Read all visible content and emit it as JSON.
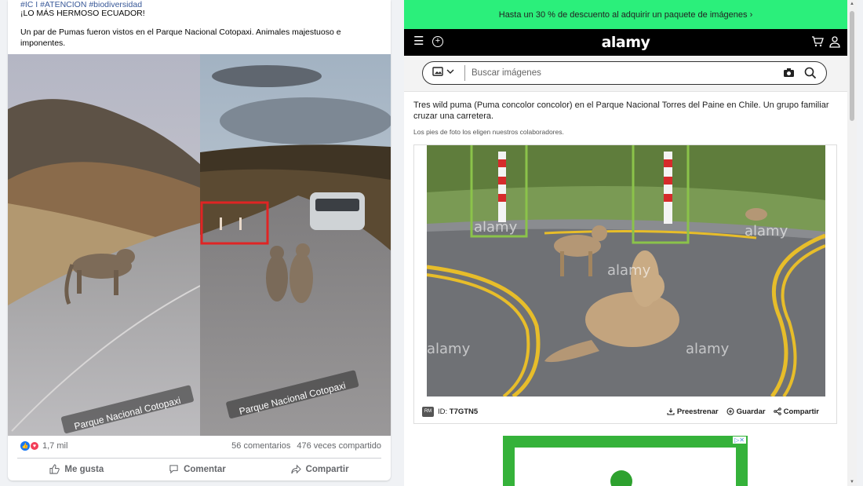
{
  "post": {
    "hashtags": "#IC I #ATENCION #biodiversidad",
    "headline": "¡LO MÁS HERMOSO ECUADOR!",
    "caption": "Un par de Pumas fueron vistos en el Parque Nacional Cotopaxi. Animales majestuoso e imponentes.",
    "photo_label_left": "Parque Nacional Cotopaxi",
    "photo_label_right": "Parque Nacional Cotopaxi",
    "reactions_count": "1,7 mil",
    "comments": "56 comentarios",
    "shares": "476 veces compartido",
    "actions": {
      "like": "Me gusta",
      "comment": "Comentar",
      "share": "Compartir"
    },
    "highlight_color": "#e02424"
  },
  "site": {
    "promo": "Hasta un 30 % de descuento al adquirir un paquete de imágenes ›",
    "logo": "alamy",
    "search_placeholder": "Buscar imágenes",
    "description": "Tres wild puma (Puma concolor concolor) en el Parque Nacional Torres del Paine en Chile. Un grupo familiar cruzar una carretera.",
    "caption_note": "Los pies de foto los eligen nuestros colaboradores.",
    "rf_badge": "RM",
    "image_id_label": "ID:",
    "image_id": "T7GTN5",
    "actions": {
      "preview": "Preestrenar",
      "save": "Guardar",
      "share": "Compartir"
    },
    "watermark": "alamy",
    "highlight_color": "#8bc34a",
    "promo_color": "#2bef7b"
  }
}
